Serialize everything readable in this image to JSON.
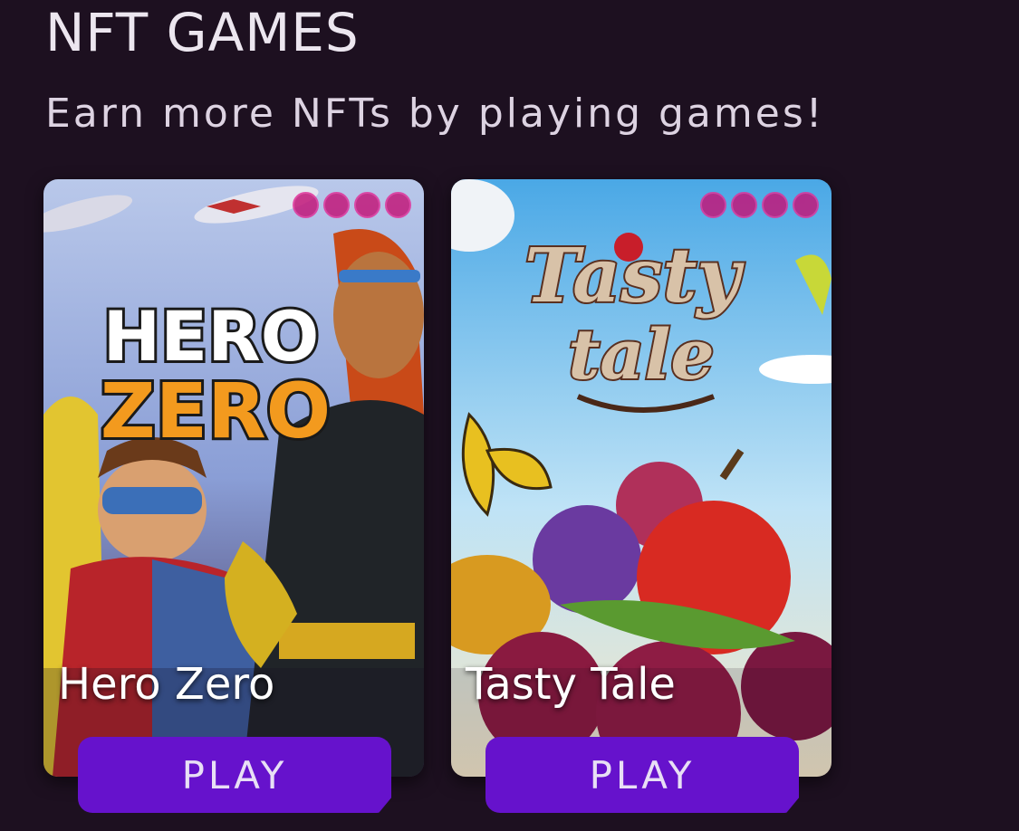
{
  "header": {
    "title": "NFT GAMES",
    "subtitle": "Earn more NFTs by playing games!"
  },
  "games": [
    {
      "name": "Hero Zero",
      "logo_line1": "HERO",
      "logo_line2": "ZERO",
      "button_label": "PLAY",
      "icon": "hero-zero-cover-art"
    },
    {
      "name": "Tasty Tale",
      "logo_line1": "Tasty",
      "logo_line2": "tale",
      "button_label": "PLAY",
      "icon": "tasty-tale-cover-art"
    }
  ],
  "colors": {
    "background": "#1d1020",
    "button": "#6612cc",
    "badge": "#c2187a"
  }
}
